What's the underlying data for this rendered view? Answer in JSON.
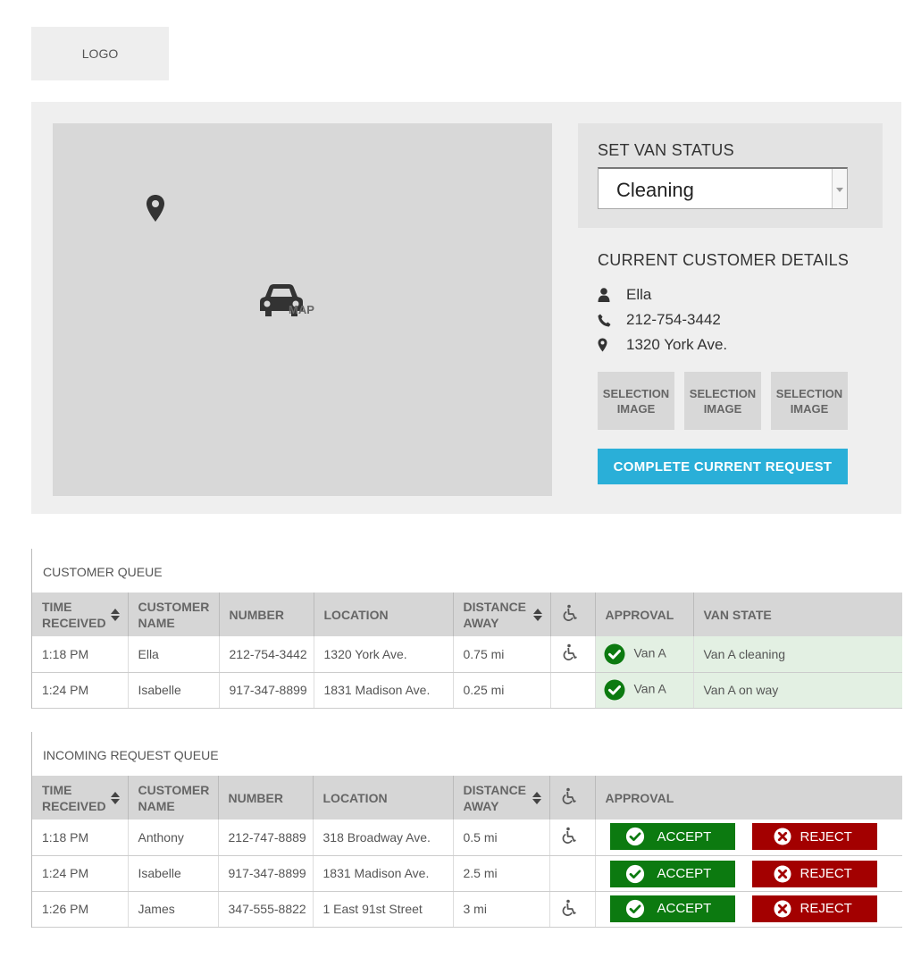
{
  "header": {
    "logo_text": "LOGO"
  },
  "map": {
    "label": "MAP"
  },
  "van_status": {
    "title": "SET VAN STATUS",
    "selected": "Cleaning"
  },
  "customer": {
    "title": "CURRENT CUSTOMER DETAILS",
    "name": "Ella",
    "phone": "212-754-3442",
    "address": "1320 York Ave."
  },
  "selection_images": [
    "SELECTION IMAGE",
    "SELECTION IMAGE",
    "SELECTION IMAGE"
  ],
  "complete_button": "COMPLETE CURRENT REQUEST",
  "customer_queue": {
    "title": "CUSTOMER QUEUE",
    "columns": [
      "TIME RECEIVED",
      "CUSTOMER NAME",
      "NUMBER",
      "LOCATION",
      "DISTANCE AWAY",
      "wheelchair-icon",
      "APPROVAL",
      "VAN STATE"
    ],
    "rows": [
      {
        "time": "1:18 PM",
        "name": "Ella",
        "number": "212-754-3442",
        "location": "1320 York Ave.",
        "distance": "0.75 mi",
        "wheelchair": true,
        "approval": "Van A",
        "van_state": "Van A cleaning"
      },
      {
        "time": "1:24 PM",
        "name": "Isabelle",
        "number": "917-347-8899",
        "location": "1831 Madison Ave.",
        "distance": "0.25 mi",
        "wheelchair": false,
        "approval": "Van A",
        "van_state": "Van A on way"
      }
    ]
  },
  "incoming_queue": {
    "title": "INCOMING REQUEST QUEUE",
    "columns": [
      "TIME RECEIVED",
      "CUSTOMER NAME",
      "NUMBER",
      "LOCATION",
      "DISTANCE AWAY",
      "wheelchair-icon",
      "APPROVAL"
    ],
    "accept_label": "ACCEPT",
    "reject_label": "REJECT",
    "rows": [
      {
        "time": "1:18 PM",
        "name": "Anthony",
        "number": "212-747-8889",
        "location": "318 Broadway Ave.",
        "distance": "0.5 mi",
        "wheelchair": true
      },
      {
        "time": "1:24 PM",
        "name": "Isabelle",
        "number": "917-347-8899",
        "location": "1831 Madison Ave.",
        "distance": "2.5 mi",
        "wheelchair": false
      },
      {
        "time": "1:26 PM",
        "name": "James",
        "number": "347-555-8822",
        "location": "1 East 91st Street",
        "distance": "3 mi",
        "wheelchair": true
      }
    ]
  },
  "colors": {
    "accent": "#2aafd8",
    "accept": "#0c7a10",
    "reject": "#a30000",
    "approved_row": "#e3f0e3",
    "check": "#0c7a10"
  }
}
